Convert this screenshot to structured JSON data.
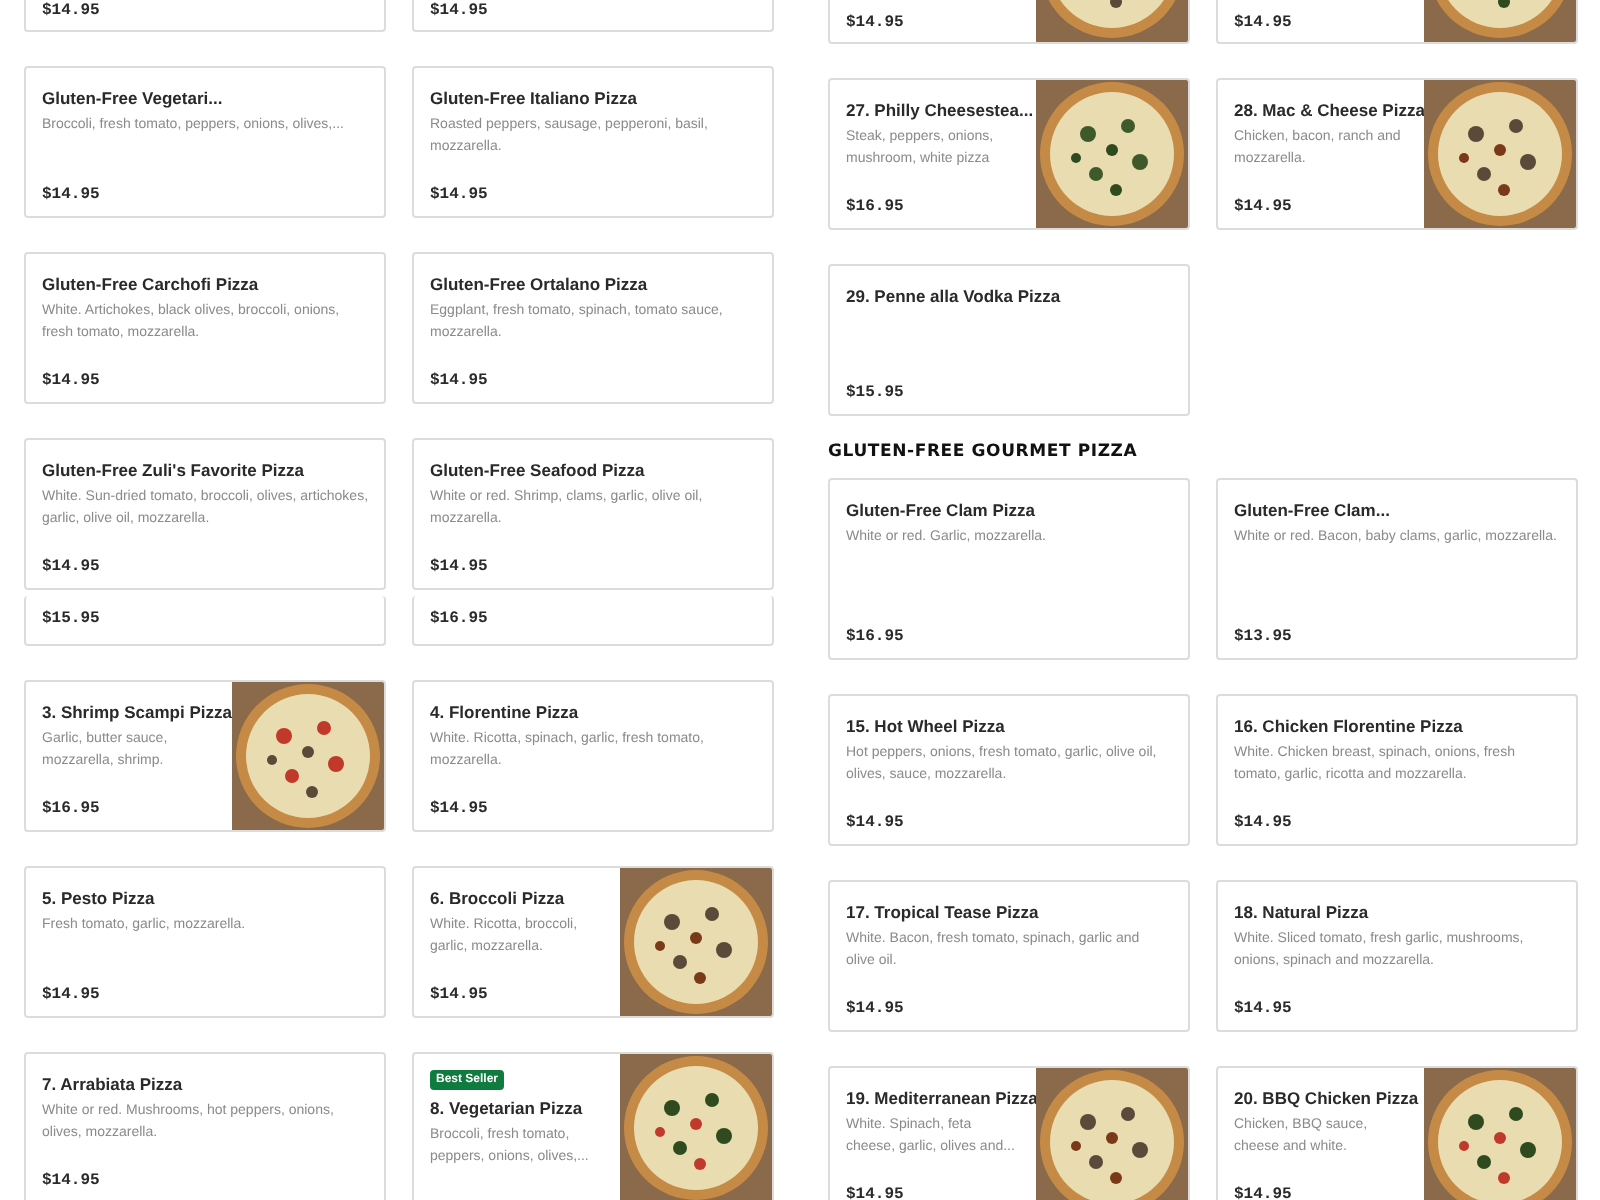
{
  "columns": [
    {
      "rows": [
        {
          "kind": "top-cut",
          "cards": [
            {
              "price": "$14.95",
              "photo": false
            },
            {
              "price": "$14.95",
              "photo": false
            }
          ]
        },
        {
          "kind": "cards",
          "cards": [
            {
              "title": "Gluten-Free Vegetari...",
              "description": "Broccoli, fresh tomato, peppers, onions, olives,...",
              "price": "$14.95",
              "photo": false
            },
            {
              "title": "Gluten-Free Italiano Pizza",
              "description": "Roasted peppers, sausage, pepperoni, basil, mozzarella.",
              "price": "$14.95",
              "photo": false
            }
          ]
        },
        {
          "kind": "cards",
          "cards": [
            {
              "title": "Gluten-Free Carchofi Pizza",
              "description": "White. Artichokes, black olives, broccoli, onions, fresh tomato, mozzarella.",
              "price": "$14.95",
              "photo": false
            },
            {
              "title": "Gluten-Free Ortalano Pizza",
              "description": "Eggplant, fresh tomato, spinach, tomato sauce, mozzarella.",
              "price": "$14.95",
              "photo": false
            }
          ]
        },
        {
          "kind": "cards",
          "cards": [
            {
              "title": "Gluten-Free Zuli's Favorite Pizza",
              "description": "White. Sun-dried tomato, broccoli, olives, artichokes, garlic, olive oil, mozzarella.",
              "price": "$14.95",
              "photo": false
            },
            {
              "title": "Gluten-Free Seafood Pizza",
              "description": "White or red. Shrimp, clams, garlic, olive oil, mozzarella.",
              "price": "$14.95",
              "photo": false
            }
          ]
        },
        {
          "kind": "seam",
          "cards": [
            {
              "price": "$15.95",
              "photo": false
            },
            {
              "price": "$16.95",
              "photo": false
            }
          ]
        },
        {
          "kind": "cards",
          "cards": [
            {
              "title": "3. Shrimp Scampi Pizza",
              "description": "Garlic, butter sauce, mozzarella, shrimp.",
              "price": "$16.95",
              "photo": true
            },
            {
              "title": "4. Florentine Pizza",
              "description": "White. Ricotta, spinach, garlic, fresh tomato, mozzarella.",
              "price": "$14.95",
              "photo": false
            }
          ]
        },
        {
          "kind": "cards",
          "cards": [
            {
              "title": "5. Pesto Pizza",
              "description": "Fresh tomato, garlic, mozzarella.",
              "price": "$14.95",
              "photo": false
            },
            {
              "title": "6. Broccoli Pizza",
              "description": "White. Ricotta, broccoli, garlic, mozzarella.",
              "price": "$14.95",
              "photo": true
            }
          ]
        },
        {
          "kind": "cards",
          "cards": [
            {
              "title": "7. Arrabiata Pizza",
              "description": "White or red. Mushrooms, hot peppers, onions, olives, mozzarella.",
              "price": "$14.95",
              "photo": false
            },
            {
              "badge": "Best Seller",
              "title": "8. Vegetarian Pizza",
              "description": "Broccoli, fresh tomato, peppers, onions, olives,...",
              "photo": true
            }
          ]
        }
      ]
    },
    {
      "rows": [
        {
          "kind": "top-cut",
          "cards": [
            {
              "price": "$14.95",
              "photo": true
            },
            {
              "price": "$14.95",
              "photo": true
            }
          ]
        },
        {
          "kind": "cards",
          "cards": [
            {
              "title": "27. Philly Cheesestea...",
              "description": "Steak, peppers, onions, mushroom, white pizza",
              "price": "$16.95",
              "photo": true
            },
            {
              "title": "28. Mac & Cheese Pizza",
              "description": "Chicken, bacon, ranch and mozzarella.",
              "price": "$14.95",
              "photo": true
            }
          ]
        },
        {
          "kind": "cards",
          "cards": [
            {
              "title": "29. Penne alla Vodka Pizza",
              "price": "$15.95",
              "photo": false
            }
          ]
        },
        {
          "kind": "heading",
          "text": "GLUTEN-FREE GOURMET PIZZA"
        },
        {
          "kind": "tall",
          "cards": [
            {
              "title": "Gluten-Free Clam Pizza",
              "description": "White or red. Garlic, mozzarella.",
              "price": "$16.95",
              "photo": false
            },
            {
              "title": "Gluten-Free Clam...",
              "description": "White or red. Bacon, baby clams, garlic, mozzarella.",
              "price": "$13.95",
              "photo": false
            }
          ]
        },
        {
          "kind": "cards",
          "cards": [
            {
              "title": "15. Hot Wheel Pizza",
              "description": "Hot peppers, onions, fresh tomato, garlic, olive oil, olives, sauce, mozzarella.",
              "price": "$14.95",
              "photo": false
            },
            {
              "title": "16. Chicken Florentine Pizza",
              "description": "White. Chicken breast, spinach, onions, fresh tomato, garlic, ricotta and mozzarella.",
              "price": "$14.95",
              "photo": false
            }
          ]
        },
        {
          "kind": "cards",
          "cards": [
            {
              "title": "17. Tropical Tease Pizza",
              "description": "White. Bacon, fresh tomato, spinach, garlic and olive oil.",
              "price": "$14.95",
              "photo": false
            },
            {
              "title": "18. Natural Pizza",
              "description": "White. Sliced tomato, fresh garlic, mushrooms, onions, spinach and mozzarella.",
              "price": "$14.95",
              "photo": false
            }
          ]
        },
        {
          "kind": "cards",
          "cards": [
            {
              "title": "19. Mediterranean Pizza",
              "description": "White. Spinach, feta cheese, garlic, olives and...",
              "price": "$14.95",
              "photo": true
            },
            {
              "title": "20. BBQ Chicken Pizza",
              "description": "Chicken, BBQ sauce, cheese and white.",
              "price": "$14.95",
              "photo": true
            }
          ]
        }
      ]
    }
  ]
}
